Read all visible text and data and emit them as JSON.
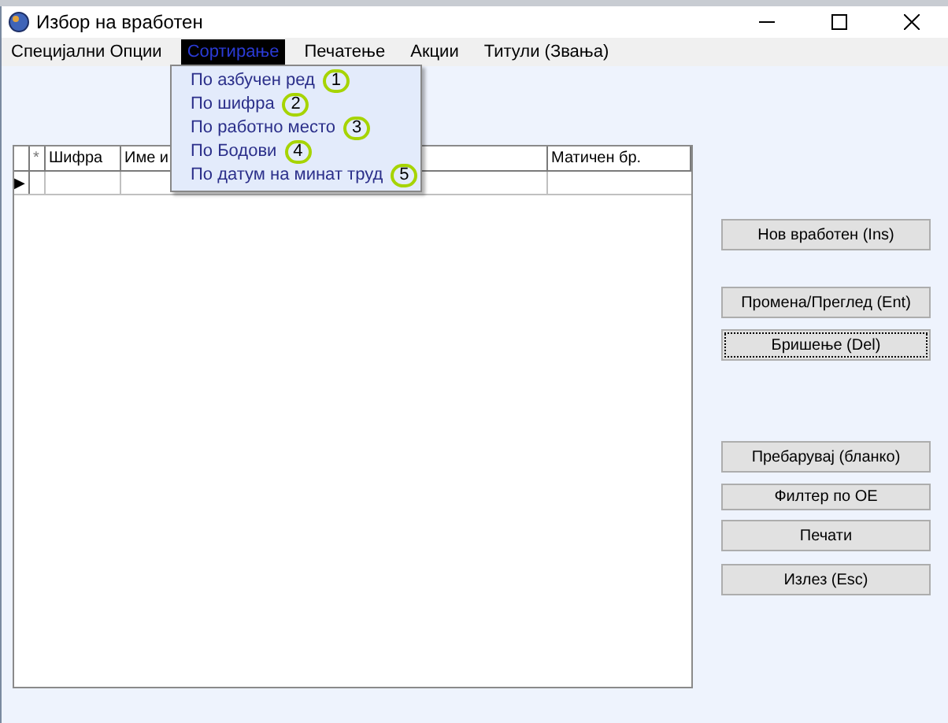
{
  "window": {
    "title": "Избор на вработен"
  },
  "menu": [
    {
      "label": "Специјални Опции",
      "selected": false
    },
    {
      "label": "Сортирање",
      "selected": true
    },
    {
      "label": "Печатење",
      "selected": false
    },
    {
      "label": "Акции",
      "selected": false
    },
    {
      "label": "Титули (Звања)",
      "selected": false
    }
  ],
  "dropdown": [
    {
      "label": "По азбучен ред",
      "callout": "1"
    },
    {
      "label": "По шифра",
      "callout": "2"
    },
    {
      "label": "По работно место",
      "callout": "3"
    },
    {
      "label": "По Бодови",
      "callout": "4"
    },
    {
      "label": "По датум на минат труд",
      "callout": "5"
    }
  ],
  "table": {
    "columns": [
      "*",
      "Шифра",
      "Име и",
      "Матичен бр."
    ],
    "current_row_marker": "▶"
  },
  "buttons": [
    {
      "label": "Нов вработен (Ins)",
      "focused": false
    },
    {
      "label": "Промена/Преглед (Ent)",
      "focused": false
    },
    {
      "label": "Бришење (Del)",
      "focused": true
    },
    {
      "label": "Пребарувај (бланко)",
      "focused": false
    },
    {
      "label": "Филтер по ОЕ",
      "focused": false
    },
    {
      "label": "Печати",
      "focused": false
    },
    {
      "label": "Излез (Esc)",
      "focused": false
    }
  ]
}
